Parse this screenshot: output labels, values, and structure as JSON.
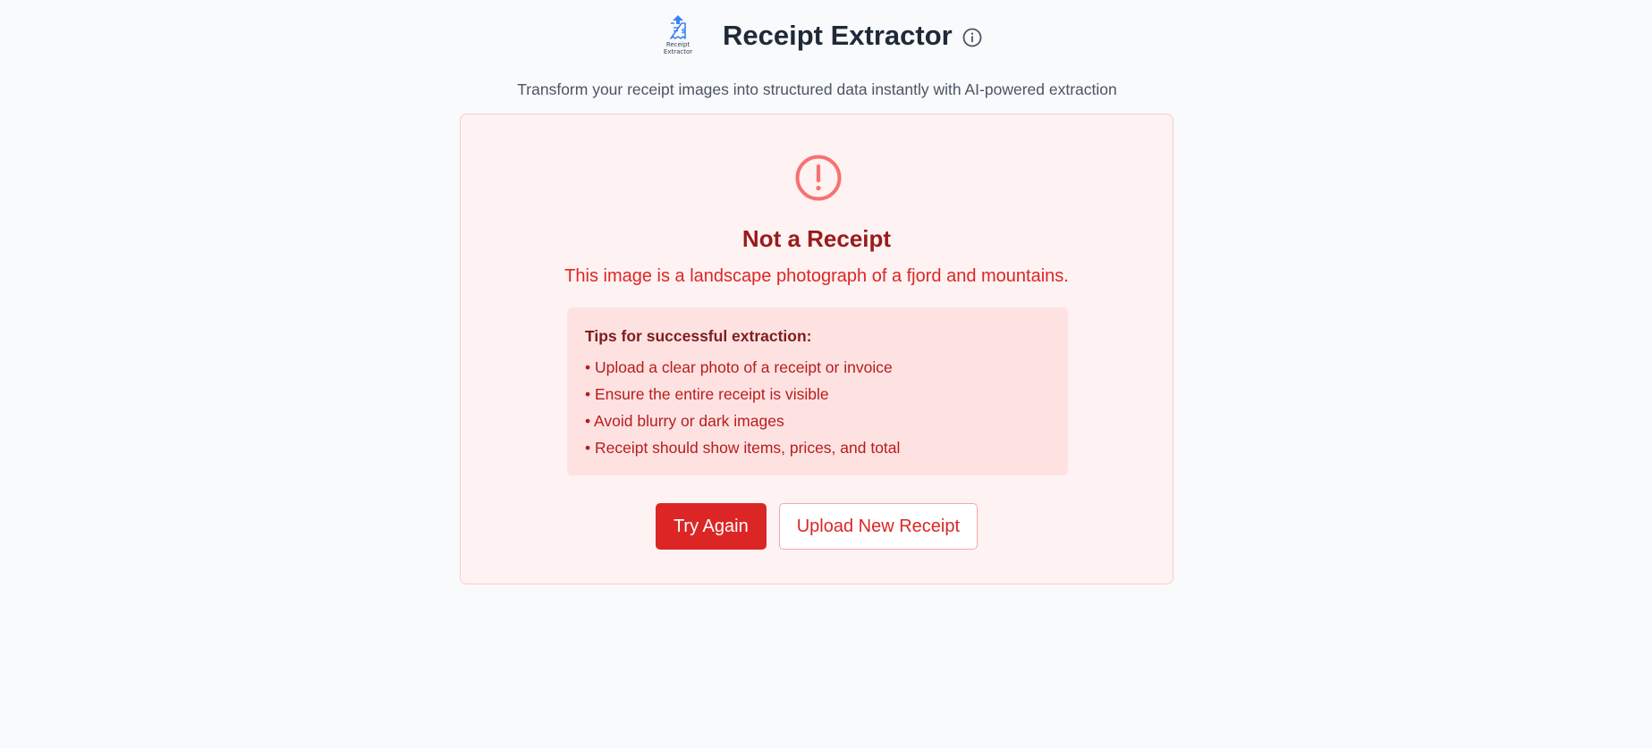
{
  "header": {
    "logo_text_line1": "Receipt",
    "logo_text_line2": "Extractor",
    "title": "Receipt Extractor",
    "info_icon": "info-circle-icon",
    "logo_icon": "receipt-upload-icon"
  },
  "subtitle": "Transform your receipt images into structured data instantly with AI-powered extraction",
  "error_card": {
    "icon": "alert-circle-icon",
    "title": "Not a Receipt",
    "message": "This image is a landscape photograph of a fjord and mountains.",
    "tips": {
      "title": "Tips for successful extraction:",
      "items": [
        "• Upload a clear photo of a receipt or invoice",
        "• Ensure the entire receipt is visible",
        "• Avoid blurry or dark images",
        "• Receipt should show items, prices, and total"
      ]
    },
    "buttons": {
      "try_again": "Try Again",
      "upload_new": "Upload New Receipt"
    }
  },
  "colors": {
    "accent": "#dc2626",
    "card_bg": "#fef2f2",
    "tips_bg": "#fee2e2",
    "title_dark_red": "#991b1b",
    "logo_blue": "#3b82f6"
  }
}
